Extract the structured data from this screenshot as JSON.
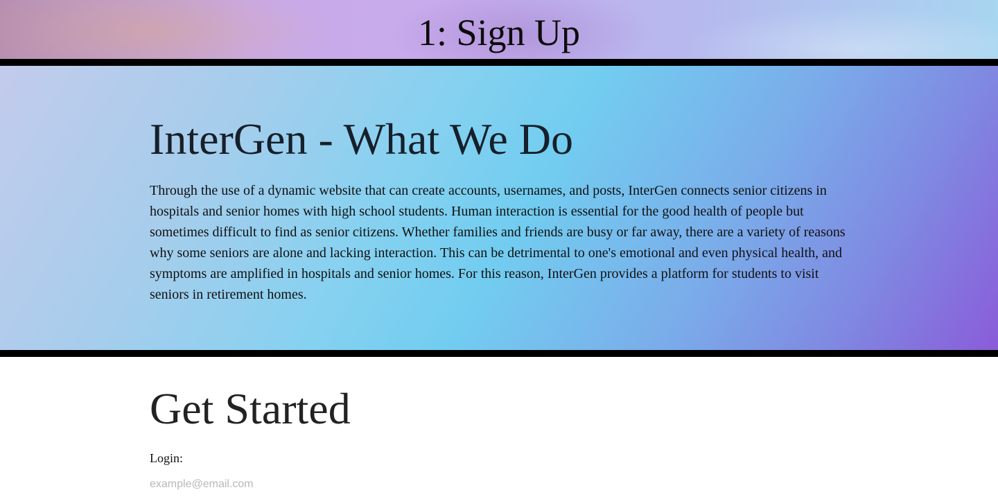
{
  "banner": {
    "title": "1: Sign Up"
  },
  "about": {
    "heading": "InterGen - What We Do",
    "body": "Through the use of a dynamic website that can create accounts, usernames, and posts, InterGen connects senior citizens in hospitals and senior homes with high school students. Human interaction is essential for the good health of people but sometimes difficult to find as senior citizens. Whether families and friends are busy or far away, there are a variety of reasons why some seniors are alone and lacking interaction. This can be detrimental to one's emotional and even physical health, and symptoms are amplified in hospitals and senior homes. For this reason, InterGen provides a platform for students to visit seniors in retirement homes."
  },
  "get_started": {
    "heading": "Get Started",
    "login_label": "Login:",
    "email_placeholder": "example@email.com",
    "email_value": ""
  },
  "colors": {
    "divider": "#000000",
    "heading_text": "#16202a",
    "placeholder": "#b8b8b8"
  }
}
